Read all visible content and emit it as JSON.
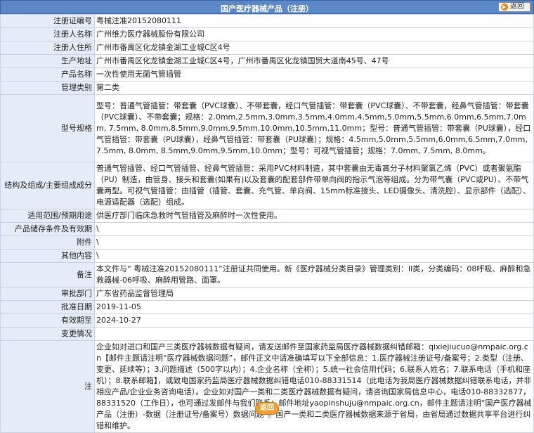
{
  "header": {
    "title": "国产医疗器械产品（注册）",
    "back_label": "返回"
  },
  "rows": [
    {
      "label": "注册证编号",
      "value": "粤械注准20152080111"
    },
    {
      "label": "注册人名称",
      "value": "广州维力医疗器械股份有限公司"
    },
    {
      "label": "注册人住所",
      "value": "广州市番禺区化龙镇金湖工业城C区4号"
    },
    {
      "label": "生产地址",
      "value": "广州市番禺区化龙镇金湖工业城C区4号，广州市番禺区化龙镇国贸大道南45号、47号"
    },
    {
      "label": "产品名称",
      "value": "一次性使用无菌气管插管"
    },
    {
      "label": "管理类别",
      "value": "第二类"
    },
    {
      "label": "型号规格",
      "value": "型号：普通气管插管：带套囊（PVC球囊）、不带套囊，经口气管插管：带套囊（PVC球囊）、不带套囊，经鼻气管插管：带套囊（PVC球囊）、不带套囊；规格：2.0mm,2.5mm,3.0mm,3.5mm,4.0mm,4.5mm,5.0mm,5.5mm,6.0mm,6.5mm,7.0mm, 7.5mm, 8.0mm,8.5mm,9.0mm,9.5mm,10.0mm,10.5mm,11.0mm；型号：普通气管插管：带套囊（PU球囊），经口气管插管：带套囊（PU球囊），经鼻气管插管：带套囊（PU球囊）；规格：4.5mm,5.0mm,5.5mm,6.0mm,6.5mm,7.0mm,7.5mm, 8.0mm, 8.5mm,9.0mm,9.5mm,10.0mm；型号：可视气管插管；规格：7.0mm, 7.5mm, 8.0mm。"
    },
    {
      "label": "结构及组成/主要组成成分",
      "value": "普通气管插管、经口气管插管、经鼻气管插管：采用PVC材料制造，其中套囊由无毒高分子材料聚氯乙烯（PVC）或者聚氨酯（PU）制造，由管身、接头和套囊(如果有)以及套囊的配套部件带单向阀的指示气泡等组成。分为带气囊（PVC或PU）、不带气囊两型。可视气管插管：由插管（插管、套囊、充气管、单向阀、15mm标准接头、LED摄像头、清洗腔）、显示部件（选配）、电源适配器（选配）组成。"
    },
    {
      "label": "适用范围/预期用途",
      "value": "供医疗部门临床急救时气管插管及麻醉时一次性使用。"
    },
    {
      "label": "产品储存条件及有效期",
      "value": "\\"
    },
    {
      "label": "附件",
      "value": "\\"
    },
    {
      "label": "其他内容",
      "value": "\\"
    },
    {
      "label": "备注",
      "value": "本文件与“ 粤械注准20152080111”注册证共同使用。新《医疗器械分类目录》管理类别：II类，分类编码：08呼吸、麻醉和急救器械-06呼吸、麻醉用管路、面罩。"
    },
    {
      "label": "审批部门",
      "value": "广东省药品监督管理局"
    },
    {
      "label": "批准日期",
      "value": "2019-11-05"
    },
    {
      "label": "有效期至",
      "value": "2024-10-27"
    },
    {
      "label": "变更情况",
      "value": ""
    },
    {
      "label": "注",
      "value": "企业如对进口和国产三类医疗器械数据有疑问，请发送邮件至国家药监局医疗器械数据纠错邮箱：qixiejiucuo@nmpaic.org.cn【邮件主题请注明“医疗器械数据问题”，邮件正文中请准确填写以下全部信息：1.医疗器械注册证号/备案号；2.类型（注册、变更、延续等）；3.问题描述（500字以内）；4.企业名称（全称）；5.统一社会信用代码；6.联系人姓名；7.联系电话（手机和座机）；8.联系邮箱】，或致电国家药监局医疗器械数据纠错电话010-88331514（此电话为我局医疗器械数据纠错联系电话，并非相应产品/企业业务咨询电话）。企业如对国产一类和二类医疗器械数据有疑问，请咨询国家局信息中心，电话010-88332877，88331520（工作日），也可通过发邮件与我们联系：邮件地址yaopinshuju@nmpaic.org.cn，邮件主题请注明“国产医疗器械产品（注册）-数据（注册证号/备案号）数据问题”。国产一类和二类医疗器械数据来源于省局，由省局通过数据共享平台进行纠错和维护。"
    }
  ],
  "footer": {
    "back_label": "返回"
  }
}
